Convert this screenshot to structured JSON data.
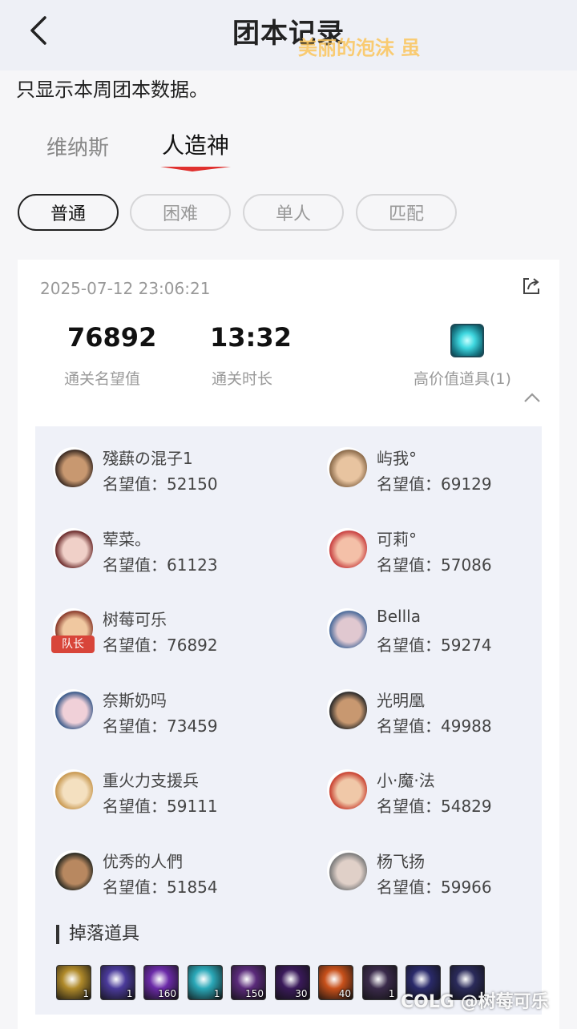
{
  "header": {
    "title": "团本记录",
    "danmaku": "美丽的泡沫 虽"
  },
  "notice": "只显示本周团本数据。",
  "tabs": [
    {
      "label": "维纳斯"
    },
    {
      "label": "人造神"
    }
  ],
  "modes": [
    {
      "label": "普通"
    },
    {
      "label": "困难"
    },
    {
      "label": "单人"
    },
    {
      "label": "匹配"
    }
  ],
  "record": {
    "datetime": "2025-07-12 23:06:21",
    "renown_value": "76892",
    "renown_label": "通关名望值",
    "duration_value": "13:32",
    "duration_label": "通关时长",
    "high_value_label": "高价值道具(1)"
  },
  "players": [
    {
      "name": "殘蕻の混子1",
      "renown": "名望值：52150"
    },
    {
      "name": "屿我°",
      "renown": "名望值：69129"
    },
    {
      "name": "荤菜。",
      "renown": "名望值：61123"
    },
    {
      "name": "可莉°",
      "renown": "名望值：57086"
    },
    {
      "name": "树莓可乐",
      "renown": "名望值：76892",
      "tag": "队长"
    },
    {
      "name": "Bellla",
      "renown": "名望值：59274"
    },
    {
      "name": "奈斯奶吗",
      "renown": "名望值：73459"
    },
    {
      "name": "光明凰",
      "renown": "名望值：49988"
    },
    {
      "name": "重火力支援兵",
      "renown": "名望值：59111"
    },
    {
      "name": "小·魔·法",
      "renown": "名望值：54829"
    },
    {
      "name": "优秀的人們",
      "renown": "名望值：51854"
    },
    {
      "name": "杨飞扬",
      "renown": "名望值：59966"
    }
  ],
  "drops": {
    "title": "掉落道具",
    "items": [
      {
        "count": "1",
        "color": "#b08a2a"
      },
      {
        "count": "1",
        "color": "#4a3a9a"
      },
      {
        "count": "160",
        "color": "#6b2aa8"
      },
      {
        "count": "1",
        "color": "#2aa8b8"
      },
      {
        "count": "150",
        "color": "#5a2a7a"
      },
      {
        "count": "30",
        "color": "#3a1a5a"
      },
      {
        "count": "40",
        "color": "#c8501a"
      },
      {
        "count": "1",
        "color": "#3a2a4a"
      },
      {
        "count": "",
        "color": "#2a2a6a"
      },
      {
        "count": "",
        "color": "#2a2a5a"
      }
    ]
  },
  "watermark": "COLG @树莓可乐",
  "colors": {
    "accent_red": "#e0312f",
    "leader_tag": "#d8453a"
  }
}
